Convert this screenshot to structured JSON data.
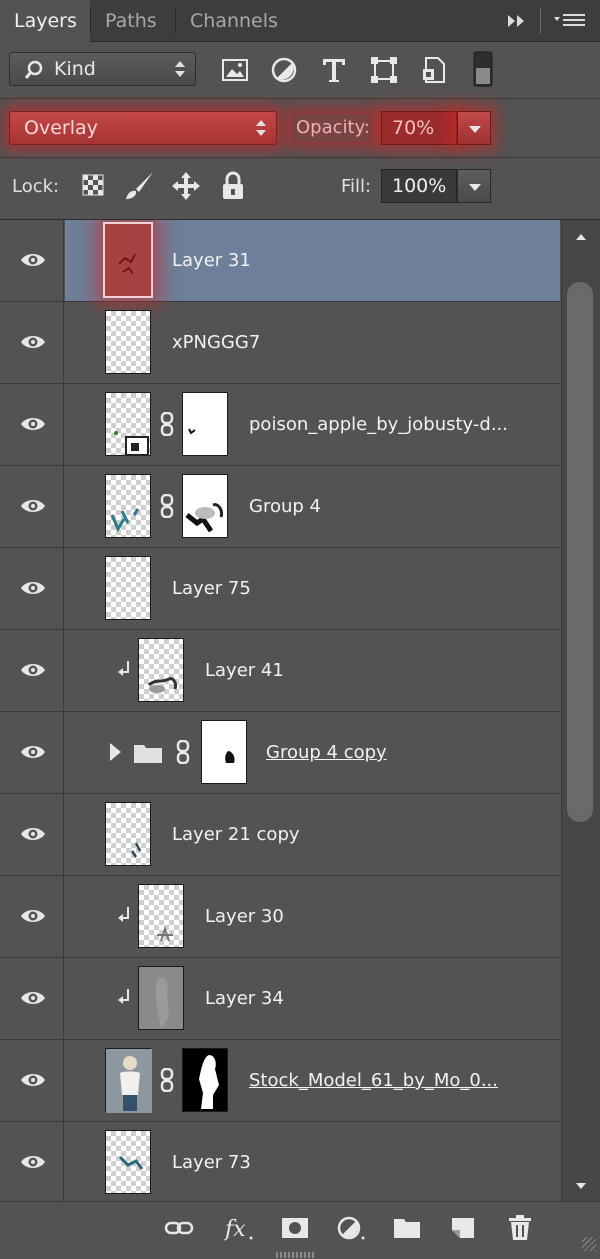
{
  "tabs": [
    {
      "label": "Layers",
      "active": true
    },
    {
      "label": "Paths",
      "active": false
    },
    {
      "label": "Channels",
      "active": false
    }
  ],
  "filter": {
    "kind_label": "Kind"
  },
  "blend": {
    "mode": "Overlay",
    "opacity_label": "Opacity:",
    "opacity_value": "70%"
  },
  "lock": {
    "label": "Lock:",
    "fill_label": "Fill:",
    "fill_value": "100%"
  },
  "layers": [
    {
      "name": "Layer 31",
      "selected": true
    },
    {
      "name": "xPNGGG7"
    },
    {
      "name": "poison_apple_by_jobusty-d..."
    },
    {
      "name": "Group 4"
    },
    {
      "name": "Layer 75"
    },
    {
      "name": "Layer 41"
    },
    {
      "name": "Group 4 copy"
    },
    {
      "name": "Layer 21 copy"
    },
    {
      "name": "Layer 30"
    },
    {
      "name": "Layer 34"
    },
    {
      "name": "Stock_Model_61_by_Mo_0..."
    },
    {
      "name": "Layer 73"
    }
  ],
  "colors": {
    "accent_red": "#c44848",
    "selection": "#6d7f99",
    "panel": "#535353"
  },
  "icons": [
    "eye-icon",
    "link-icon",
    "fx-icon",
    "mask-icon",
    "adjustment-icon",
    "folder-icon",
    "new-layer-icon",
    "trash-icon"
  ]
}
